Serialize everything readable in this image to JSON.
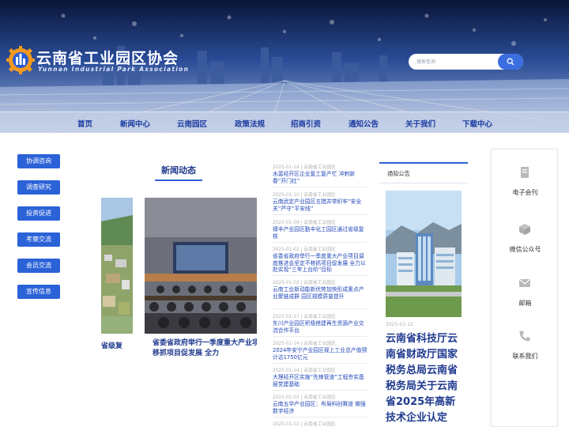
{
  "header": {
    "logo_title": "云南省工业园区协会",
    "logo_subtitle": "Yunnan Industrial Park Association",
    "search_placeholder": "搜索查询"
  },
  "nav": {
    "items": [
      {
        "label": "首页"
      },
      {
        "label": "新闻中心"
      },
      {
        "label": "云南园区"
      },
      {
        "label": "政策法规"
      },
      {
        "label": "招商引资"
      },
      {
        "label": "通知公告"
      },
      {
        "label": "关于我们"
      },
      {
        "label": "下载中心"
      }
    ]
  },
  "left_menu": {
    "items": [
      {
        "label": "协调咨询"
      },
      {
        "label": "调查研究"
      },
      {
        "label": "投资促进"
      },
      {
        "label": "考察交流"
      },
      {
        "label": "会员交流"
      },
      {
        "label": "宣传信息"
      }
    ]
  },
  "news_center": {
    "heading": "新闻动态",
    "slides": [
      {
        "caption": "省级复"
      },
      {
        "caption": "省委省政府举行一季度重大产业项目推进会坚定不移抓项目促发展 全力"
      }
    ]
  },
  "news_list": {
    "items": [
      {
        "date": "2025-01-14 | 云南省工业园区",
        "title": "水富经开区企业复工复产忙 冲刺新春“开门红”"
      },
      {
        "date": "2025-01-10 | 云南省工业园区",
        "title": "云南武定产业园区五措并举织牢“安全关”严守“平安线”"
      },
      {
        "date": "2025-01-09 | 云南省工业园区",
        "title": "禄丰产业园区勤丰化工园区通过省级复核"
      },
      {
        "date": "2025-01-02 | 云南省工业园区",
        "title": "省委省政府举行一季度重大产业项目调度推进会坚定不移抓项目促发展 全力以赴实现“三年上台阶”目标"
      },
      {
        "date": "2025-01-02 | 云南省工业园区",
        "title": "云南工业新动能新优势加快形成重点产业聚链成群 园区规模质量提升"
      },
      {
        "date": "2025-01-17 | 云南省工业园区",
        "title": "东川产业园区积极搭建再生资源产业交流合作平台"
      },
      {
        "date": "2025-01-14 | 云南省工业园区",
        "title": "2024年安宁产业园区规上工业总产值预计达1750亿元"
      },
      {
        "date": "2025-01-14 | 云南省工业园区",
        "title": "大理经开区实施“先锋管道”工程夯实基层党建基础"
      },
      {
        "date": "2025-01-03 | 云南省工业园区",
        "title": "云南五华产业园区：布局科创赛道 做强数字经济"
      },
      {
        "date": "2025-01-02 | 云南省工业园区",
        "title": ""
      }
    ]
  },
  "notice": {
    "label": "通知公告",
    "date": "2025-01-12",
    "title": "云南省科技厅云南省财政厅国家税务总局云南省税务局关于云南省2025年高新技术企业认定"
  },
  "right_sidebar": {
    "items": [
      {
        "label": "电子会刊",
        "icon": "book-icon"
      },
      {
        "label": "微信公众号",
        "icon": "cube-icon"
      },
      {
        "label": "邮箱",
        "icon": "mail-icon"
      },
      {
        "label": "联系我们",
        "icon": "phone-icon"
      }
    ]
  },
  "colors": {
    "primary": "#2b62d8",
    "nav_text": "#1d3aa0",
    "heading": "#1f3a8f",
    "link": "#2147b8"
  }
}
